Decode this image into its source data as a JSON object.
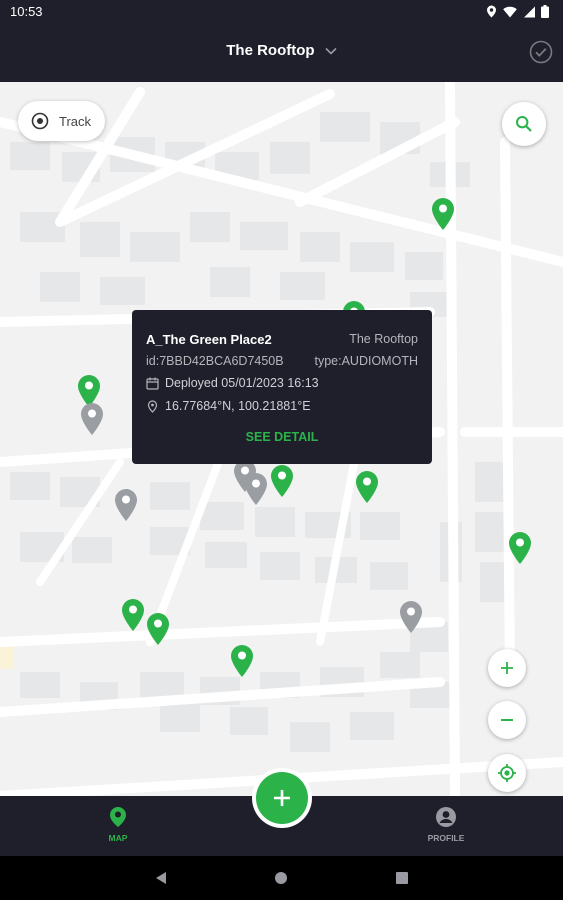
{
  "status_bar": {
    "time": "10:53"
  },
  "app_bar": {
    "title": "The Rooftop"
  },
  "map": {
    "track_label": "Track",
    "pins": [
      {
        "color": "green"
      },
      {
        "color": "green"
      },
      {
        "color": "green"
      },
      {
        "color": "gray"
      },
      {
        "color": "gray"
      },
      {
        "color": "gray"
      },
      {
        "color": "gray"
      },
      {
        "color": "green"
      },
      {
        "color": "green"
      },
      {
        "color": "green"
      },
      {
        "color": "green"
      },
      {
        "color": "green"
      },
      {
        "color": "green"
      },
      {
        "color": "gray"
      }
    ]
  },
  "popup": {
    "name": "A_The Green Place2",
    "site": "The Rooftop",
    "device_id": "id:7BBD42BCA6D7450B",
    "device_type": "type:AUDIOMOTH",
    "deployed": "Deployed 05/01/2023 16:13",
    "coordinates": "16.77684°N, 100.21881°E",
    "action": "SEE DETAIL"
  },
  "bottom_nav": {
    "items": [
      {
        "label": "MAP",
        "active": true
      },
      {
        "label": "PROFILE",
        "active": false
      }
    ]
  },
  "colors": {
    "accent": "#2bb34a",
    "bar": "#1e1f2b",
    "pin_gray": "#9a9ea3",
    "map_bg": "#f2f2f3"
  }
}
